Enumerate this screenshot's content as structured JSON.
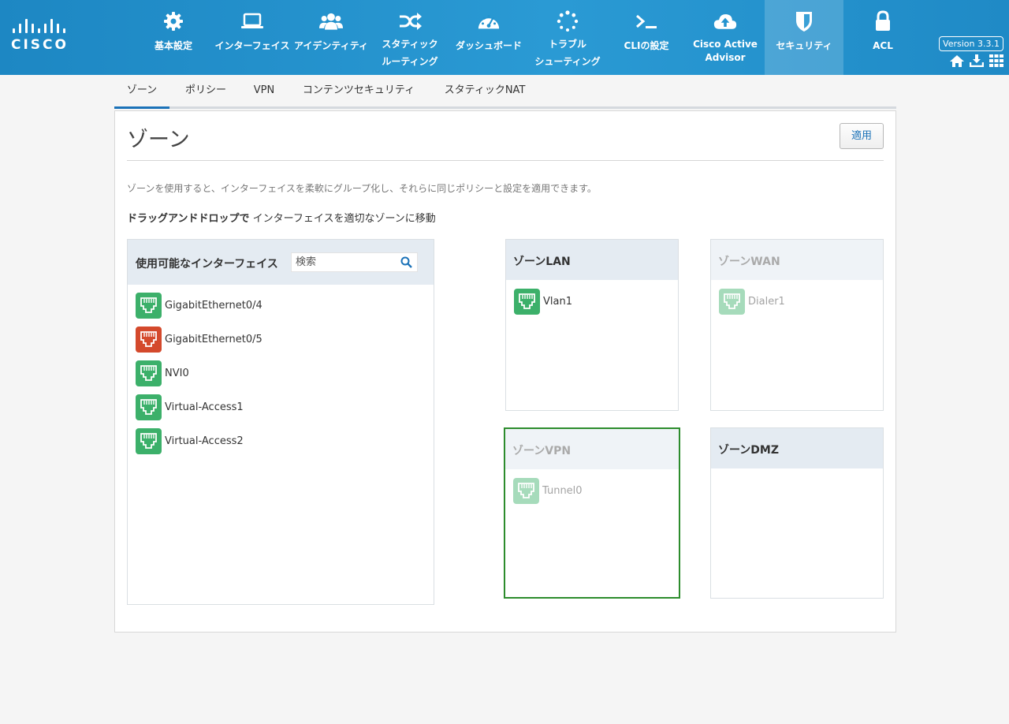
{
  "brand": {
    "logo_text": "CISCO"
  },
  "nav": {
    "items": [
      {
        "label": "基本設定",
        "icon": "gear-icon"
      },
      {
        "label": "インターフェイス",
        "icon": "laptop-icon"
      },
      {
        "label": "アイデンティティ",
        "icon": "users-icon"
      },
      {
        "label": "スタティック",
        "label2": "ルーティング",
        "icon": "shuffle-icon"
      },
      {
        "label": "ダッシュボード",
        "icon": "dashboard-icon"
      },
      {
        "label": "トラブル",
        "label2": "シューティング",
        "icon": "spinner-icon"
      },
      {
        "label": "CLIの設定",
        "icon": "terminal-icon"
      },
      {
        "label": "Cisco Active",
        "label2": "Advisor",
        "icon": "cloud-upload-icon"
      },
      {
        "label": "セキュリティ",
        "icon": "shield-icon",
        "active": true
      },
      {
        "label": "ACL",
        "icon": "lock-icon"
      }
    ],
    "version": "Version 3.3.1"
  },
  "subtabs": [
    "ゾーン",
    "ポリシー",
    "VPN",
    "コンテンツセキュリティ",
    "スタティックNAT"
  ],
  "page": {
    "title": "ゾーン",
    "apply_label": "適用",
    "description": "ゾーンを使用すると、インターフェイスを柔軟にグループ化し、それらに同じポリシーと設定を適用できます。",
    "hint_bold": "ドラッグアンドドロップで",
    "hint_rest": " インターフェイスを適切なゾーンに移動"
  },
  "available": {
    "title": "使用可能なインターフェイス",
    "search_placeholder": "検索",
    "interfaces": [
      {
        "name": "GigabitEthernet0/4",
        "status": "up"
      },
      {
        "name": "GigabitEthernet0/5",
        "status": "down"
      },
      {
        "name": "NVI0",
        "status": "up"
      },
      {
        "name": "Virtual-Access1",
        "status": "up"
      },
      {
        "name": "Virtual-Access2",
        "status": "up"
      }
    ]
  },
  "zones": {
    "lan": {
      "title": "ゾーンLAN",
      "interfaces": [
        "Vlan1"
      ]
    },
    "wan": {
      "title": "ゾーンWAN",
      "interfaces": [
        "Dialer1"
      ]
    },
    "vpn": {
      "title": "ゾーンVPN",
      "interfaces": [
        "Tunnel0"
      ]
    },
    "dmz": {
      "title": "ゾーンDMZ",
      "interfaces": []
    }
  },
  "colors": {
    "port_up": "#3cb06a",
    "port_down": "#d4492c",
    "accent": "#1b72b8",
    "selected_zone_border": "#2d8c2d"
  }
}
